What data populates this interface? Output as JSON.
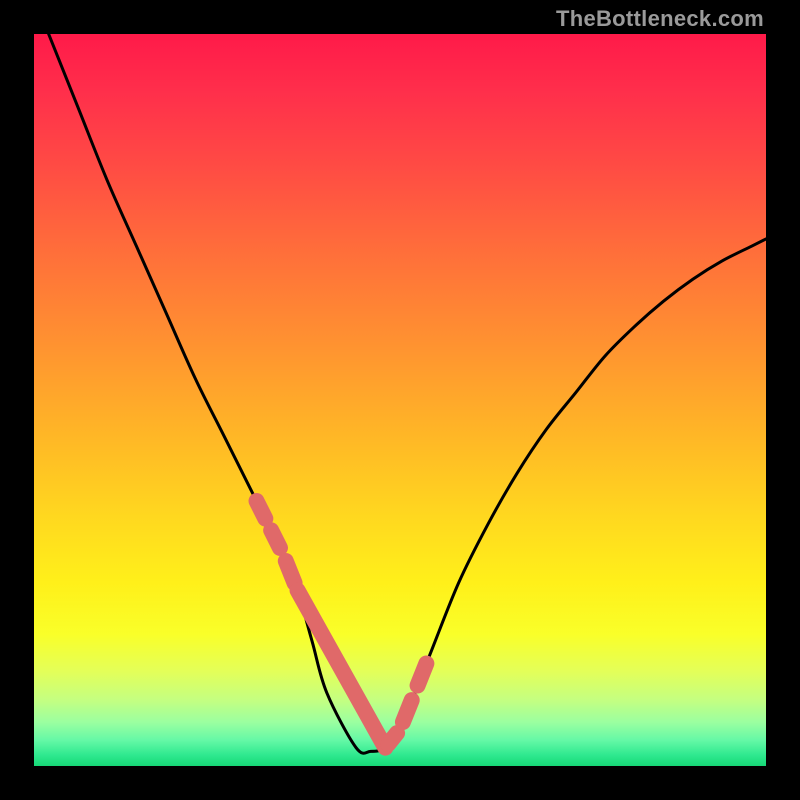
{
  "watermark": "TheBottleneck.com",
  "colors": {
    "bg_black": "#000000",
    "watermark_gray": "#9a9a9a",
    "curve_black": "#000000",
    "marker_pink": "#e06969",
    "gradient_stops": [
      {
        "offset": 0.0,
        "color": "#ff1a49"
      },
      {
        "offset": 0.08,
        "color": "#ff2f4b"
      },
      {
        "offset": 0.18,
        "color": "#ff4b44"
      },
      {
        "offset": 0.3,
        "color": "#ff6f3a"
      },
      {
        "offset": 0.43,
        "color": "#ff9430"
      },
      {
        "offset": 0.55,
        "color": "#ffb726"
      },
      {
        "offset": 0.66,
        "color": "#ffd81f"
      },
      {
        "offset": 0.75,
        "color": "#fff01a"
      },
      {
        "offset": 0.82,
        "color": "#f9ff29"
      },
      {
        "offset": 0.87,
        "color": "#e4ff58"
      },
      {
        "offset": 0.91,
        "color": "#c4ff81"
      },
      {
        "offset": 0.94,
        "color": "#9bffa0"
      },
      {
        "offset": 0.965,
        "color": "#64f8a6"
      },
      {
        "offset": 0.985,
        "color": "#2fe98f"
      },
      {
        "offset": 1.0,
        "color": "#16d876"
      }
    ]
  },
  "chart_data": {
    "type": "line",
    "title": "",
    "xlabel": "",
    "ylabel": "",
    "xlim": [
      0,
      100
    ],
    "ylim": [
      0,
      100
    ],
    "grid": false,
    "legend": false,
    "series": [
      {
        "name": "curve",
        "x": [
          2,
          6,
          10,
          14,
          18,
          22,
          26,
          30,
          32,
          34,
          36,
          38,
          40,
          44,
          46,
          48,
          50,
          54,
          58,
          62,
          66,
          70,
          74,
          78,
          82,
          86,
          90,
          94,
          98,
          100
        ],
        "y": [
          100,
          90,
          80,
          71,
          62,
          53,
          45,
          37,
          33,
          29,
          24,
          17,
          10,
          2.5,
          2,
          2.5,
          5,
          15,
          25,
          33,
          40,
          46,
          51,
          56,
          60,
          63.5,
          66.5,
          69,
          71,
          72
        ]
      }
    ],
    "highlight_points": [
      {
        "x": 30,
        "y": 37
      },
      {
        "x": 32,
        "y": 33
      },
      {
        "x": 34,
        "y": 29
      },
      {
        "x": 36,
        "y": 24
      },
      {
        "x": 38,
        "y": 17
      },
      {
        "x": 40,
        "y": 10
      },
      {
        "x": 42,
        "y": 4
      },
      {
        "x": 44,
        "y": 2.5
      },
      {
        "x": 46,
        "y": 2
      },
      {
        "x": 48,
        "y": 2.5
      },
      {
        "x": 50,
        "y": 5
      },
      {
        "x": 52,
        "y": 10
      },
      {
        "x": 54,
        "y": 15
      }
    ]
  }
}
